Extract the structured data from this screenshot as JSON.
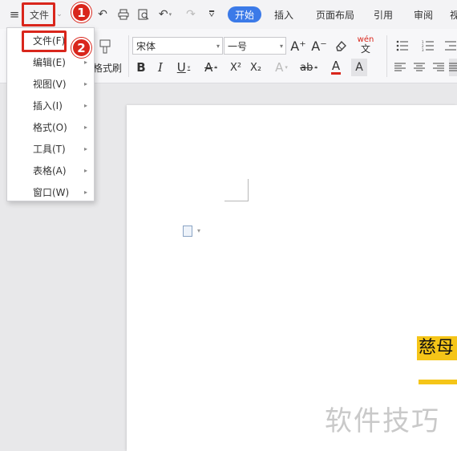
{
  "menu_bar": {
    "file_label": "文件",
    "quick_access_icons": [
      "hamburger-menu-icon",
      "undo-icon",
      "print-icon",
      "print-preview-icon",
      "undo-arrow-icon",
      "redo-icon",
      "more-dropdown-icon"
    ],
    "tabs": [
      "开始",
      "插入",
      "页面布局",
      "引用",
      "审阅",
      "视"
    ]
  },
  "ribbon": {
    "format_painter_label": "格式刷",
    "font_name": "宋体",
    "font_size": "一号",
    "bold": "B",
    "italic": "I",
    "underline": "U",
    "strikethrough": "A",
    "superscript": "X²",
    "subscript": "X₂",
    "outline_a": "A",
    "highlight": "ab",
    "font_color": "A",
    "shading_a": "A",
    "pinyin": "wén",
    "grow_font": "A⁺",
    "shrink_font": "A⁻"
  },
  "dropdown": {
    "items": [
      {
        "label": "文件(F)",
        "has_submenu": false
      },
      {
        "label": "编辑(E)",
        "has_submenu": true
      },
      {
        "label": "视图(V)",
        "has_submenu": true
      },
      {
        "label": "插入(I)",
        "has_submenu": true
      },
      {
        "label": "格式(O)",
        "has_submenu": true
      },
      {
        "label": "工具(T)",
        "has_submenu": true
      },
      {
        "label": "表格(A)",
        "has_submenu": true
      },
      {
        "label": "窗口(W)",
        "has_submenu": true
      }
    ]
  },
  "annotations": {
    "step1": "1",
    "step2": "2"
  },
  "document": {
    "highlighted_text": "慈母",
    "watermark": "软件技巧"
  },
  "colors": {
    "accent_tab": "#3b7ae8",
    "annotation_red": "#d9261c",
    "highlight_yellow": "#f5c518"
  }
}
